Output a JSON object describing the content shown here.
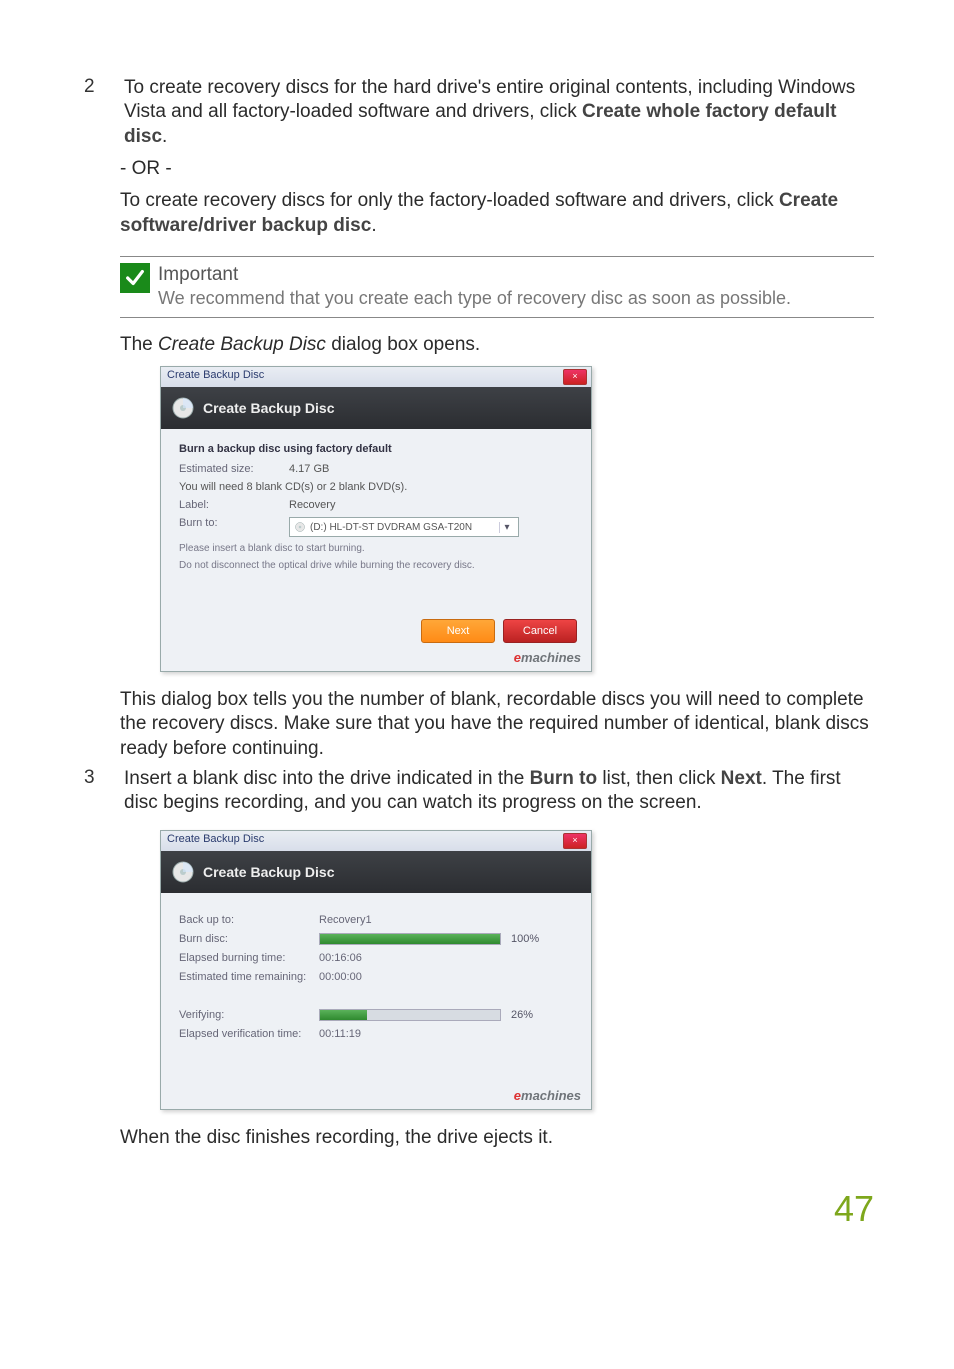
{
  "step2": {
    "num": "2",
    "para1": "To create recovery discs for the hard drive's entire original contents, including Windows Vista and all factory-loaded software and drivers, click ",
    "bold1": "Create whole factory default disc",
    "tail1": ".",
    "or": "- OR -",
    "para2a": "To create recovery discs for only the factory-loaded software and drivers, click ",
    "bold2": "Create software/driver backup disc",
    "tail2": "."
  },
  "important": {
    "title": "Important",
    "body": "We recommend that you create each type of recovery disc as soon as possible."
  },
  "openLine": {
    "pre": "The ",
    "italic": "Create Backup Disc",
    "post": " dialog box opens."
  },
  "ss1": {
    "title": "Create Backup Disc",
    "header": "Create Backup Disc",
    "section": "Burn a backup disc using factory default",
    "rows": {
      "est_label": "Estimated size:",
      "est_val": "4.17 GB",
      "need": "You will need 8 blank CD(s) or 2 blank DVD(s).",
      "label_label": "Label:",
      "label_val": "Recovery",
      "burn_label": "Burn to:",
      "burn_val": "(D:) HL-DT-ST DVDRAM GSA-T20N"
    },
    "notes": [
      "Please insert a blank disc to start burning.",
      "Do not disconnect the optical drive while burning the recovery disc."
    ],
    "next": "Next",
    "cancel": "Cancel",
    "brand_e": "e",
    "brand_rest": "machines"
  },
  "afterSS1": "This dialog box tells you the number of blank, recordable discs you will need to complete the recovery discs. Make sure that you have the required number of identical, blank discs ready before continuing.",
  "step3": {
    "num": "3",
    "text_a": "Insert a blank disc into the drive indicated in the ",
    "bold_a": "Burn to",
    "text_b": " list, then click ",
    "bold_b": "Next",
    "text_c": ". The first disc begins recording, and you can watch its progress on the screen."
  },
  "ss2": {
    "title": "Create Backup Disc",
    "header": "Create Backup Disc",
    "rows": {
      "backup_label": "Back up to:",
      "backup_val": "Recovery1",
      "burn_label": "Burn disc:",
      "burn_pct": "100%",
      "burn_fill": 100,
      "elap_label": "Elapsed burning time:",
      "elap_val": "00:16:06",
      "rem_label": "Estimated time remaining:",
      "rem_val": "00:00:00",
      "ver_label": "Verifying:",
      "ver_pct": "26%",
      "ver_fill": 26,
      "ever_label": "Elapsed verification time:",
      "ever_val": "00:11:19"
    },
    "brand_e": "e",
    "brand_rest": "machines"
  },
  "afterSS2": "When the disc finishes recording, the drive ejects it.",
  "pageNum": "47"
}
